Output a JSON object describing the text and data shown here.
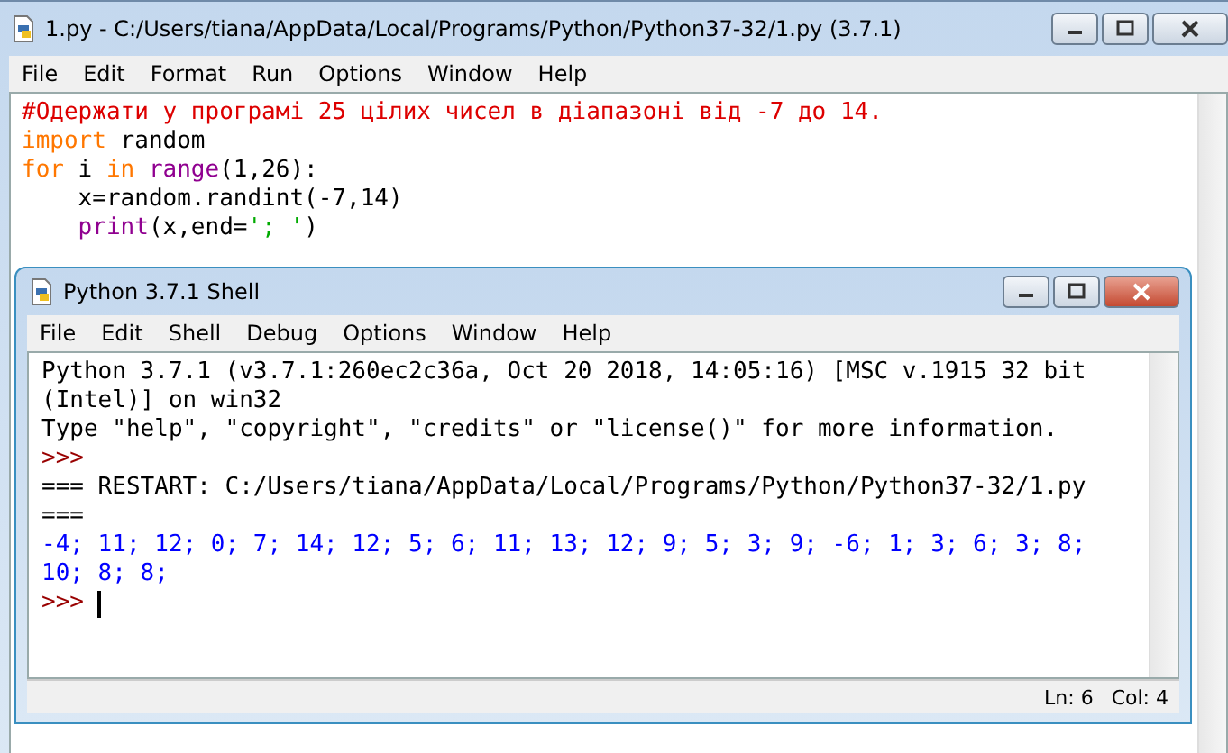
{
  "editor": {
    "title": "1.py - C:/Users/tiana/AppData/Local/Programs/Python/Python37-32/1.py (3.7.1)",
    "menu": [
      "File",
      "Edit",
      "Format",
      "Run",
      "Options",
      "Window",
      "Help"
    ],
    "code_lines": [
      [
        {
          "text": "#Одержати у програмі 25 цілих чисел в діапазоні від -7 до 14.",
          "kind": "comment"
        }
      ],
      [
        {
          "text": "import",
          "kind": "keyword"
        },
        {
          "text": " random",
          "kind": "plain"
        }
      ],
      [
        {
          "text": "for",
          "kind": "keyword"
        },
        {
          "text": " i ",
          "kind": "plain"
        },
        {
          "text": "in",
          "kind": "keyword"
        },
        {
          "text": " range",
          "kind": "builtin"
        },
        {
          "text": "(1,26):",
          "kind": "plain"
        }
      ],
      [
        {
          "text": "    x=random.randint(-7,14)",
          "kind": "plain"
        }
      ],
      [
        {
          "text": "    print",
          "kind": "builtin"
        },
        {
          "text": "(x,end=",
          "kind": "plain"
        },
        {
          "text": "'; '",
          "kind": "string"
        },
        {
          "text": ")",
          "kind": "plain"
        }
      ]
    ]
  },
  "shell": {
    "title": "Python 3.7.1 Shell",
    "menu": [
      "File",
      "Edit",
      "Shell",
      "Debug",
      "Options",
      "Window",
      "Help"
    ],
    "lines": [
      {
        "text": "Python 3.7.1 (v3.7.1:260ec2c36a, Oct 20 2018, 14:05:16) [MSC v.1915 32 bit",
        "kind": "plain"
      },
      {
        "text": "(Intel)] on win32",
        "kind": "plain"
      },
      {
        "text": "Type \"help\", \"copyright\", \"credits\" or \"license()\" for more information.",
        "kind": "plain"
      },
      {
        "text": ">>>",
        "kind": "prompt"
      },
      {
        "text": "=== RESTART: C:/Users/tiana/AppData/Local/Programs/Python/Python37-32/1.py",
        "kind": "plain"
      },
      {
        "text": "===",
        "kind": "plain"
      },
      {
        "text": "-4; 11; 12; 0; 7; 14; 12; 5; 6; 11; 13; 12; 9; 5; 3; 9; -6; 1; 3; 6; 3; 8;",
        "kind": "stdout"
      },
      {
        "text": "10; 8; 8;",
        "kind": "stdout"
      },
      {
        "text": ">>>",
        "kind": "prompt"
      }
    ],
    "status": {
      "line": "Ln: 6",
      "col": "Col: 4"
    }
  }
}
